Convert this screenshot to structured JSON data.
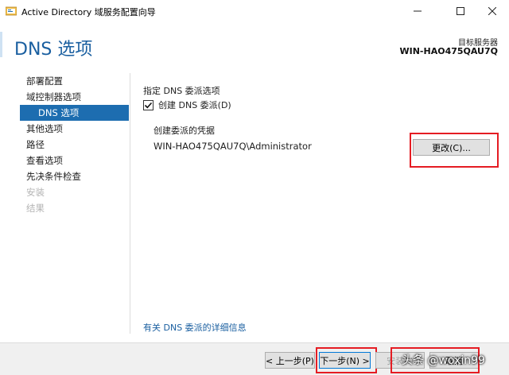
{
  "window": {
    "title": "Active Directory 域服务配置向导",
    "icon": "ad-wizard-icon"
  },
  "header": {
    "page_title": "DNS 选项",
    "target_server_label": "目标服务器",
    "target_server_name": "WIN-HAO475QAU7Q"
  },
  "nav": {
    "items": [
      {
        "label": "部署配置",
        "state": "normal"
      },
      {
        "label": "域控制器选项",
        "state": "normal"
      },
      {
        "label": "DNS 选项",
        "state": "selected"
      },
      {
        "label": "其他选项",
        "state": "normal"
      },
      {
        "label": "路径",
        "state": "normal"
      },
      {
        "label": "查看选项",
        "state": "normal"
      },
      {
        "label": "先决条件检查",
        "state": "normal"
      },
      {
        "label": "安装",
        "state": "disabled"
      },
      {
        "label": "结果",
        "state": "disabled"
      }
    ]
  },
  "content": {
    "section_label": "指定 DNS 委派选项",
    "create_delegation_label": "创建 DNS 委派(D)",
    "create_delegation_checked": true,
    "credentials_label": "创建委派的凭据",
    "credentials_value": "WIN-HAO475QAU7Q\\Administrator",
    "change_button": "更改(C)...",
    "more_info_link": "有关 DNS 委派的详细信息"
  },
  "footer": {
    "prev_button": "< 上一步(P)",
    "next_button": "下一步(N) >",
    "install_button": "安装(I)",
    "cancel_button": "取消"
  },
  "watermark": {
    "text": "头条 @woxin99"
  },
  "colors": {
    "accent": "#1d6db0",
    "title_blue": "#1a5fa0",
    "highlight_red": "#e51c23"
  }
}
